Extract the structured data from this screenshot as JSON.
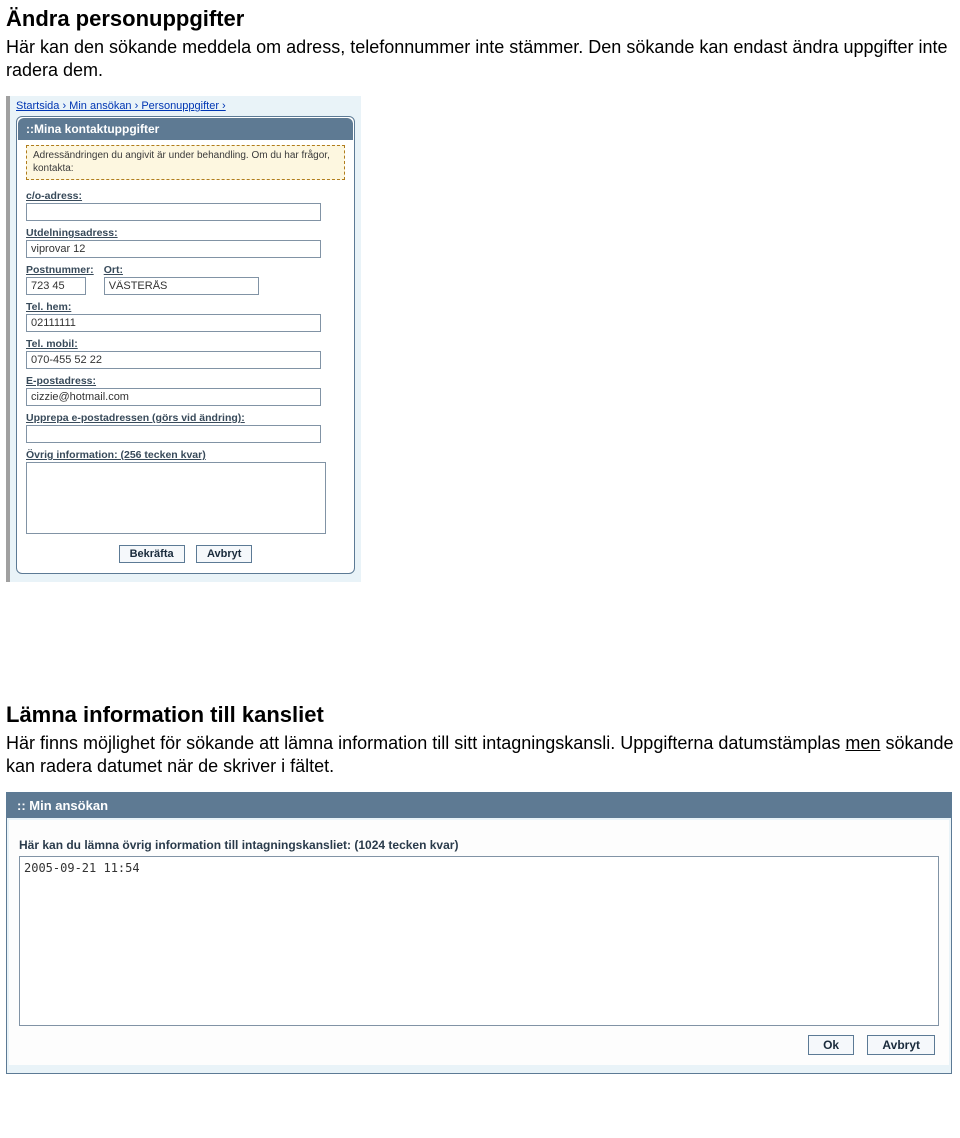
{
  "section1": {
    "heading": "Ändra personuppgifter",
    "text": "Här kan den sökande meddela om adress, telefonnummer inte stämmer. Den sökande kan endast ändra uppgifter inte radera dem."
  },
  "panel1": {
    "breadcrumb": "Startsida › Min ansökan › Personuppgifter ›",
    "title": "::Mina kontaktuppgifter",
    "notice": "Adressändringen du angivit är under behandling. Om du har frågor, kontakta:",
    "fields": {
      "co_label": "c/o-adress:",
      "co_value": "",
      "utd_label": "Utdelningsadress:",
      "utd_value": "viprovar 12",
      "pn_label": "Postnummer:",
      "pn_value": "723 45",
      "ort_label": "Ort:",
      "ort_value": "VÄSTERÅS",
      "telhem_label": "Tel. hem:",
      "telhem_value": "02111111",
      "telmob_label": "Tel. mobil:",
      "telmob_value": "070-455 52 22",
      "email_label": "E-postadress:",
      "email_value": "cizzie@hotmail.com",
      "email2_label": "Upprepa e-postadressen (görs vid ändring):",
      "email2_value": "",
      "ovrig_label": "Övrig information: (256 tecken kvar)",
      "ovrig_value": ""
    },
    "buttons": {
      "confirm": "Bekräfta",
      "cancel": "Avbryt"
    }
  },
  "section2": {
    "heading": "Lämna information till kansliet",
    "text_part1": "Här finns möjlighet för sökande att lämna information till sitt intagningskansli. Uppgifterna datumstämplas ",
    "text_part2": "men",
    "text_part3": " sökande kan radera datumet när de skriver i fältet."
  },
  "panel2": {
    "title": ":: Min ansökan",
    "label": "Här kan du lämna övrig information till intagningskansliet: (1024 tecken kvar)",
    "value": "2005-09-21 11:54",
    "buttons": {
      "ok": "Ok",
      "cancel": "Avbryt"
    }
  }
}
